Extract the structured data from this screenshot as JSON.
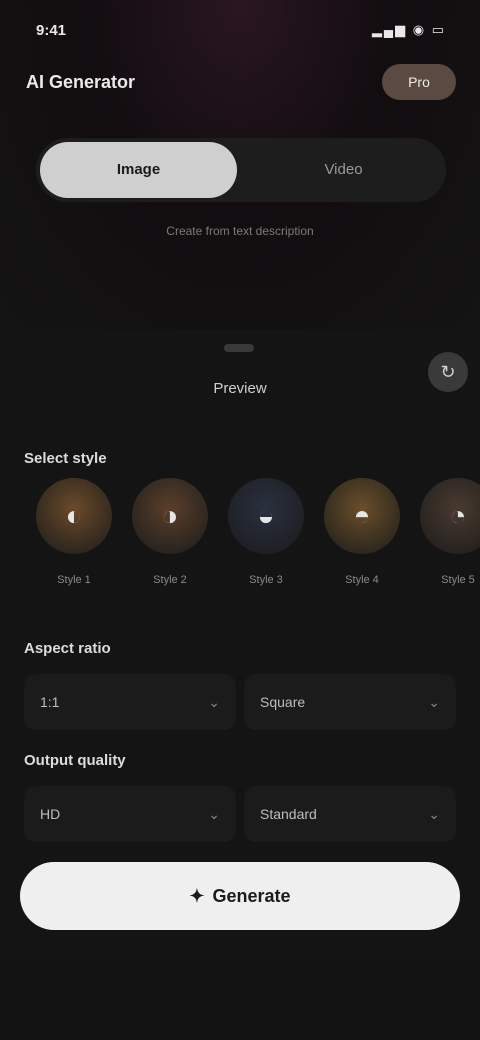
{
  "status": {
    "time": "9:41",
    "icons": "▂▄▆ ◉ ▭"
  },
  "header": {
    "title": "AI Generator",
    "pill": "Pro"
  },
  "segment": {
    "items": [
      "Image",
      "Video"
    ],
    "active_index": 0
  },
  "subtitle": "Create from text description",
  "preview": {
    "caption": "Preview",
    "button_icon": "↻"
  },
  "styles_section": {
    "title": "Select style",
    "hint": "",
    "items": [
      {
        "label": "Style 1",
        "color": "#6a4a2a",
        "icon": "◐"
      },
      {
        "label": "Style 2",
        "color": "#5a3f2a",
        "icon": "◑"
      },
      {
        "label": "Style 3",
        "color": "#2a3040",
        "icon": "◒"
      },
      {
        "label": "Style 4",
        "color": "#6a4f2a",
        "icon": "◓"
      },
      {
        "label": "Style 5",
        "color": "#4a3a30",
        "icon": "◔"
      }
    ]
  },
  "ratio_section": {
    "title": "Aspect ratio",
    "left_value": "1:1",
    "right_value": "Square"
  },
  "quality_section": {
    "title": "Output quality",
    "left_value": "HD",
    "right_value": "Standard"
  },
  "cta": {
    "label": "Generate",
    "icon": "✦"
  }
}
